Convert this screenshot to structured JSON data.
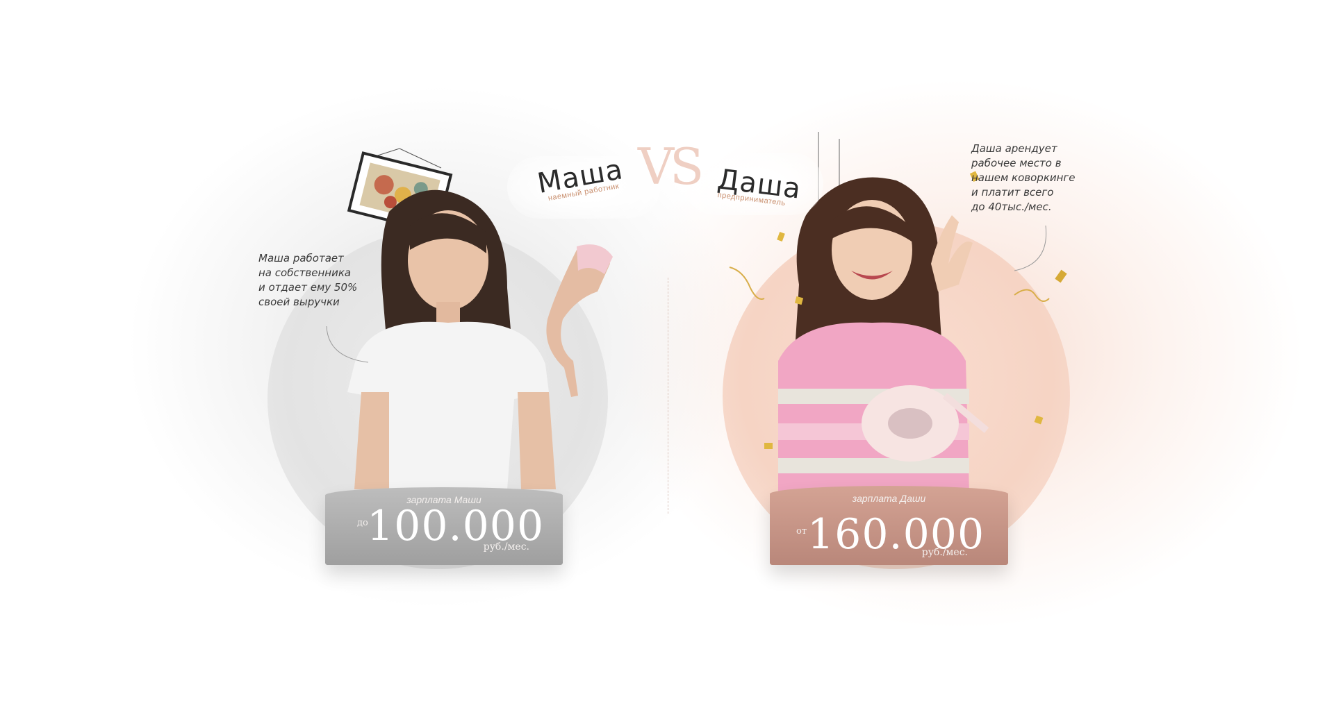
{
  "left": {
    "name": "Маша",
    "subtitle": "наемный работник",
    "description": [
      "Маша работает",
      "на собственника",
      "и отдает ему 50%",
      "своей выручки"
    ],
    "salary_caption": "зарплата Маши",
    "salary_prefix": "до",
    "salary_amount": "100.000",
    "salary_unit": "руб./мес."
  },
  "vs": "VS",
  "right": {
    "name": "Даша",
    "subtitle": "предприниматель",
    "description": [
      "Даша арендует",
      "рабочее место в",
      "нашем коворкинге",
      "и платит всего",
      "до 40тыс./мес."
    ],
    "salary_caption": "зарплата Даши",
    "salary_prefix": "от",
    "salary_amount": "160.000",
    "salary_unit": "руб./мес."
  },
  "colors": {
    "left_plaque": "#a8a8a8",
    "right_plaque": "#c4938a",
    "accent": "#c98f6e",
    "text": "#2b2b2b"
  }
}
